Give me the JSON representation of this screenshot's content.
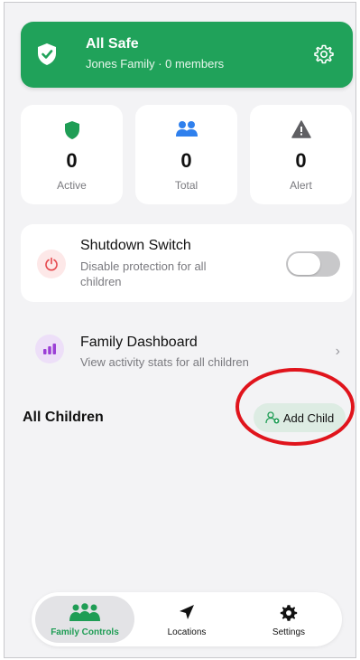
{
  "banner": {
    "title": "All Safe",
    "subtitle": "Jones Family · 0 members"
  },
  "stats": [
    {
      "value": "0",
      "label": "Active",
      "icon": "shield-icon",
      "color": "#1f9d55"
    },
    {
      "value": "0",
      "label": "Total",
      "icon": "people-icon",
      "color": "#2f80ed"
    },
    {
      "value": "0",
      "label": "Alert",
      "icon": "warning-icon",
      "color": "#5f5f63"
    }
  ],
  "shutdown": {
    "title": "Shutdown Switch",
    "description": "Disable protection for all children",
    "enabled": false
  },
  "dashboard": {
    "title": "Family Dashboard",
    "description": "View activity stats for all children"
  },
  "children": {
    "title": "All Children",
    "add_label": "Add Child"
  },
  "nav": [
    {
      "label": "Family Controls",
      "icon": "family-icon",
      "active": true
    },
    {
      "label": "Locations",
      "icon": "location-arrow-icon",
      "active": false
    },
    {
      "label": "Settings",
      "icon": "gear-icon",
      "active": false
    }
  ],
  "colors": {
    "accent": "#1f9d55",
    "annotation": "#e0141c"
  }
}
